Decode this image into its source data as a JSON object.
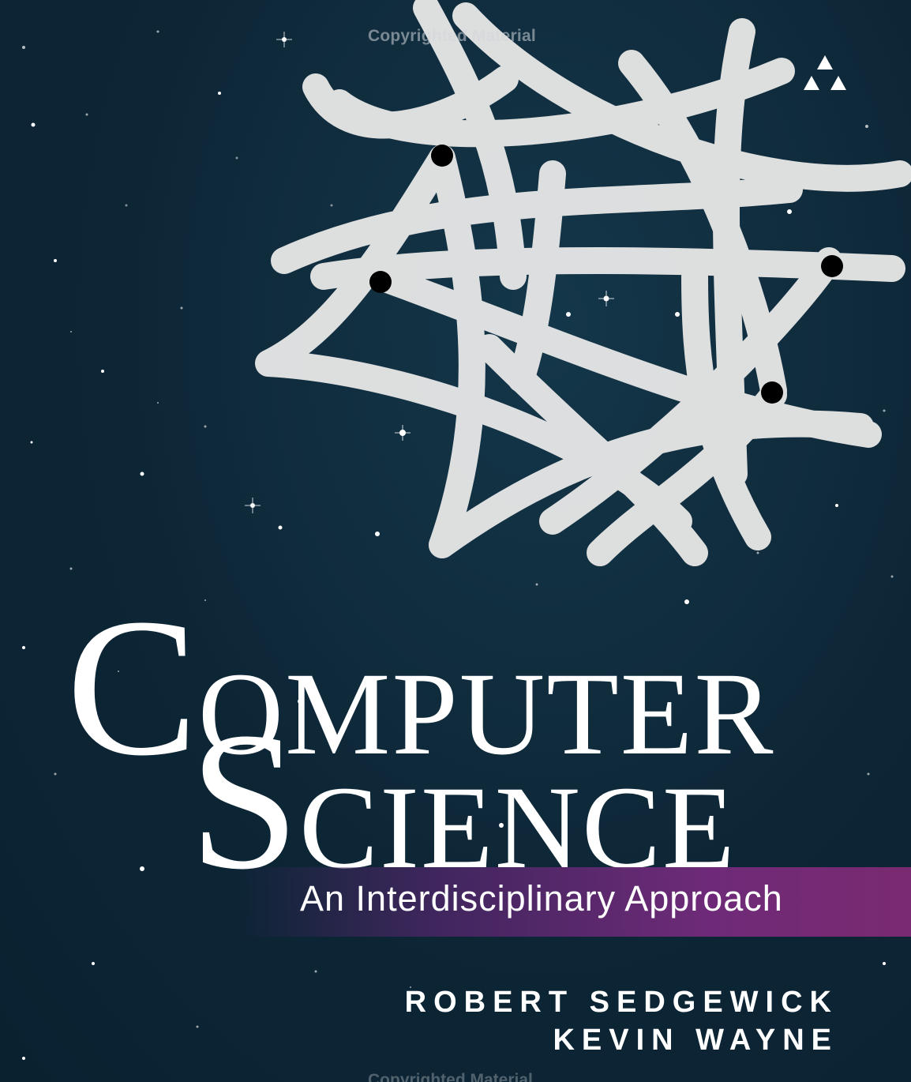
{
  "watermark": {
    "top": "Copyrighted Material",
    "bottom": "Copyrighted Material"
  },
  "publisher_logo": {
    "icon": "triangle-logo-icon",
    "color": "#ffffff"
  },
  "title": {
    "line1_initial": "C",
    "line1_rest": "OMPUTER",
    "line2_initial": "S",
    "line2_rest": "CIENCE"
  },
  "subtitle": "An Interdisciplinary Approach",
  "authors": [
    "ROBERT SEDGEWICK",
    "KEVIN WAYNE"
  ],
  "colors": {
    "background": "#0d2636",
    "knot": "#e6e6e6",
    "subtitle_band": "#6e2a78",
    "text": "#ffffff"
  }
}
